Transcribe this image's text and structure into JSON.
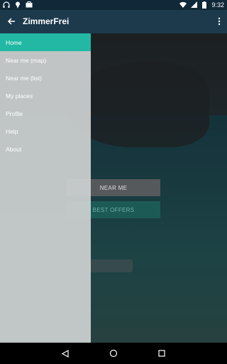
{
  "status_bar": {
    "time": "9:32",
    "icons_left": [
      "headphones-icon",
      "location-icon",
      "briefcase-icon"
    ],
    "icons_right": [
      "wifi-icon",
      "signal-icon",
      "battery-icon"
    ]
  },
  "app_bar": {
    "title": "ZimmerFrei",
    "back_icon": "arrow-back-icon",
    "menu_icon": "more-vert-icon"
  },
  "drawer": {
    "items": [
      {
        "label": "Home",
        "active": true
      },
      {
        "label": "Near me (map)",
        "active": false
      },
      {
        "label": "Near me (list)",
        "active": false
      },
      {
        "label": "My places",
        "active": false
      },
      {
        "label": "Profile",
        "active": false
      },
      {
        "label": "Help",
        "active": false
      },
      {
        "label": "About",
        "active": false
      }
    ]
  },
  "main": {
    "near_me_label": "NEAR ME",
    "best_offers_label": "BEST OFFERS"
  },
  "colors": {
    "accent": "#22b8a3",
    "appbar": "#1d3a4d",
    "statusbar": "#102838"
  }
}
